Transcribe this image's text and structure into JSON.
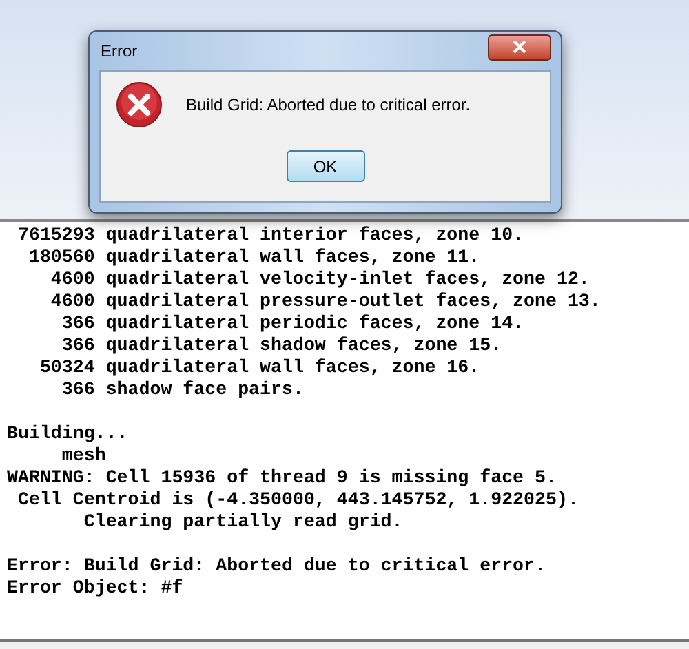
{
  "dialog": {
    "title": "Error",
    "message": "Build Grid: Aborted due to critical error.",
    "buttons": [
      "OK"
    ]
  },
  "console": {
    "blocks": [
      [
        " 7615293 quadrilateral interior faces, zone 10.",
        "  180560 quadrilateral wall faces, zone 11.",
        "    4600 quadrilateral velocity-inlet faces, zone 12.",
        "    4600 quadrilateral pressure-outlet faces, zone 13.",
        "     366 quadrilateral periodic faces, zone 14.",
        "     366 quadrilateral shadow faces, zone 15.",
        "   50324 quadrilateral wall faces, zone 16.",
        "     366 shadow face pairs."
      ],
      [
        "Building...",
        "     mesh",
        "WARNING: Cell 15936 of thread 9 is missing face 5.",
        " Cell Centroid is (-4.350000, 443.145752, 1.922025).",
        "       Clearing partially read grid."
      ],
      [
        "Error: Build Grid: Aborted due to critical error.",
        "Error Object: #f"
      ]
    ]
  }
}
